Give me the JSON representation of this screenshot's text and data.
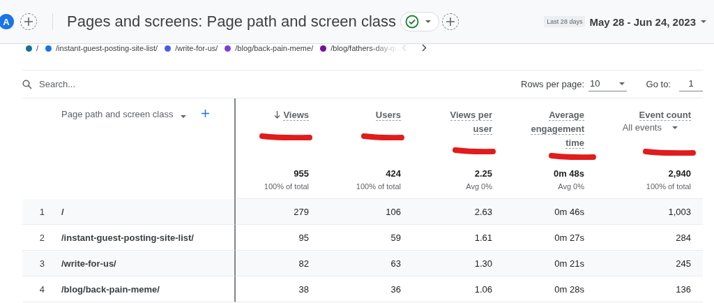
{
  "header": {
    "avatar": "A",
    "title": "Pages and screens: Page path and screen class",
    "verified": true,
    "range_chip": "Last 28 days",
    "date_range": "May 28 - Jun 24, 2023"
  },
  "legend": [
    {
      "label": "/",
      "color": "#12739c"
    },
    {
      "label": "/instant-guest-posting-site-list/",
      "color": "#1a73e8"
    },
    {
      "label": "/write-for-us/",
      "color": "#4c5ae8"
    },
    {
      "label": "/blog/back-pain-meme/",
      "color": "#7e3fd6"
    },
    {
      "label": "/blog/fathers-day-qu",
      "color": "#7b0a9e"
    }
  ],
  "toolbar": {
    "search_placeholder": "Search...",
    "rows_label": "Rows per page:",
    "rows_value": "10",
    "goto_label": "Go to:",
    "goto_value": "1"
  },
  "table": {
    "dimension": "Page path and screen class",
    "columns": [
      {
        "label": "Views",
        "sorted": true,
        "marked": true,
        "total": "955",
        "total_note": "100% of total"
      },
      {
        "label": "Users",
        "sorted": false,
        "marked": true,
        "total": "424",
        "total_note": "100% of total"
      },
      {
        "label": "Views per user",
        "sorted": false,
        "marked": true,
        "total": "2.25",
        "total_note": "Avg 0%"
      },
      {
        "label": "Average engagement time",
        "sorted": false,
        "marked": true,
        "total": "0m 48s",
        "total_note": "Avg 0%"
      },
      {
        "label": "Event count",
        "filter": "All events",
        "sorted": false,
        "marked": true,
        "total": "2,940",
        "total_note": "100% of total"
      }
    ],
    "rows": [
      {
        "index": "1",
        "path": "/",
        "cells": [
          "279",
          "106",
          "2.63",
          "0m 46s",
          "1,003"
        ]
      },
      {
        "index": "2",
        "path": "/instant-guest-posting-site-list/",
        "cells": [
          "95",
          "59",
          "1.61",
          "0m 27s",
          "284"
        ]
      },
      {
        "index": "3",
        "path": "/write-for-us/",
        "cells": [
          "82",
          "63",
          "1.30",
          "0m 21s",
          "245"
        ]
      },
      {
        "index": "4",
        "path": "/blog/back-pain-meme/",
        "cells": [
          "38",
          "36",
          "1.06",
          "0m 28s",
          "136"
        ]
      }
    ]
  }
}
